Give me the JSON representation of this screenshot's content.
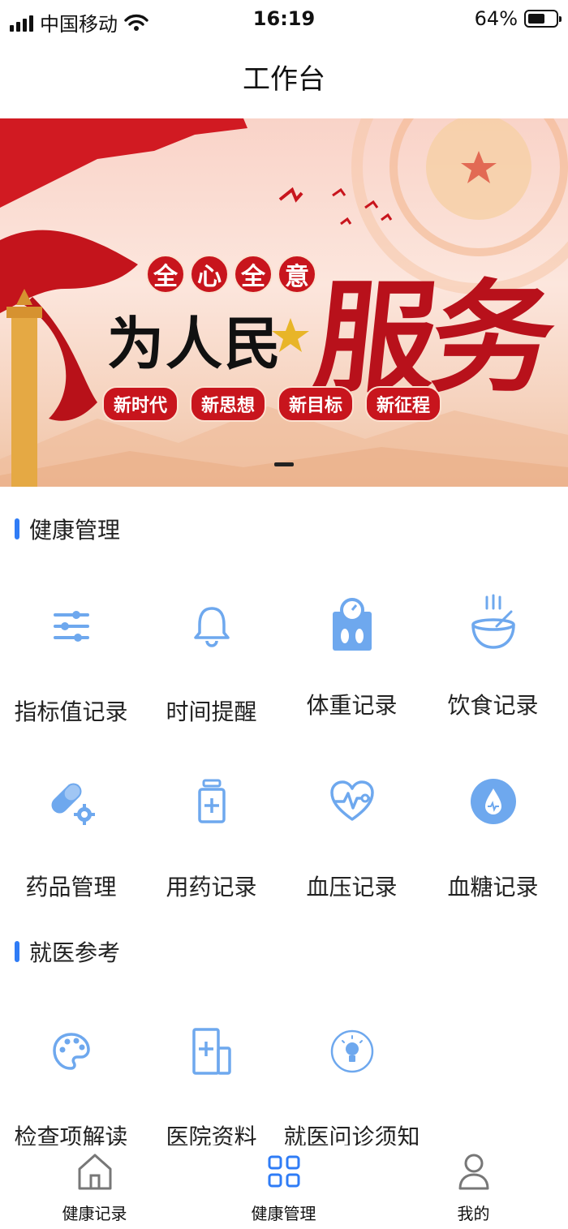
{
  "status_bar": {
    "carrier": "中国移动",
    "time": "16:19",
    "battery_percent_text": "64%",
    "battery_level": 0.64
  },
  "header": {
    "title": "工作台"
  },
  "banner": {
    "slogan_top": [
      "全",
      "心",
      "全",
      "意"
    ],
    "slogan_main": "为人民",
    "slogan_big": "服务",
    "pills": [
      "新时代",
      "新思想",
      "新目标",
      "新征程"
    ],
    "pager": {
      "current": 1,
      "total": 1
    }
  },
  "sections": {
    "health": {
      "title": "健康管理",
      "items": [
        {
          "label": "指标值记录",
          "icon": "sliders-icon"
        },
        {
          "label": "时间提醒",
          "icon": "bell-icon"
        },
        {
          "label": "体重记录",
          "icon": "weight-scale-icon"
        },
        {
          "label": "饮食记录",
          "icon": "food-bowl-icon"
        },
        {
          "label": "药品管理",
          "icon": "pill-gear-icon"
        },
        {
          "label": "用药记录",
          "icon": "medicine-bottle-icon"
        },
        {
          "label": "血压记录",
          "icon": "heart-pulse-icon"
        },
        {
          "label": "血糖记录",
          "icon": "blood-drop-icon"
        }
      ]
    },
    "medical": {
      "title": "就医参考",
      "items": [
        {
          "label": "检查项解读",
          "icon": "palette-icon"
        },
        {
          "label": "医院资料",
          "icon": "hospital-icon"
        },
        {
          "label": "就医问诊须知",
          "icon": "lightbulb-icon"
        }
      ]
    }
  },
  "tabbar": {
    "tabs": [
      {
        "label": "健康记录",
        "icon": "home-icon",
        "active": false
      },
      {
        "label": "健康管理",
        "icon": "grid-icon",
        "active": true
      },
      {
        "label": "我的",
        "icon": "user-icon",
        "active": false
      }
    ]
  },
  "colors": {
    "accent": "#2f7cf6",
    "icon_blue": "#6ea8ee",
    "banner_red": "#c8151d"
  }
}
